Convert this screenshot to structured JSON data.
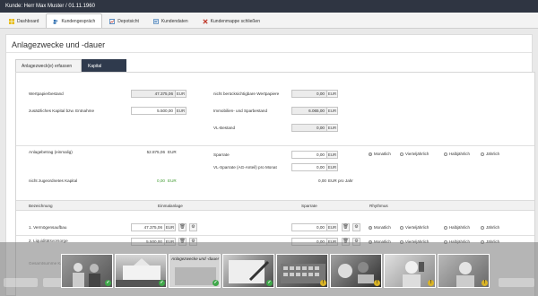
{
  "window": {
    "title": "Kunde: Herr Max Muster / 01.11.1960"
  },
  "nav": {
    "tabs": [
      {
        "label": "Dashboard",
        "icon": "dashboard-icon",
        "color": "#e6b800"
      },
      {
        "label": "Kundengespräch",
        "icon": "conversation-icon",
        "color": "#2f6fb0"
      },
      {
        "label": "Depotsicht",
        "icon": "depot-icon",
        "color": "#2f6fb0"
      },
      {
        "label": "Kundendaten",
        "icon": "customer-data-icon",
        "color": "#2f6fb0"
      },
      {
        "label": "Kundenmappe schließen",
        "icon": "close-x-icon",
        "color": "#c0392b"
      }
    ]
  },
  "page": {
    "title": "Anlagezwecke und -dauer",
    "subtabs": [
      "Anlagezweck(e) erfassen",
      "Kapital zuordnen"
    ]
  },
  "form": {
    "wertpapierbestand": {
      "label": "Wertpapierbestand",
      "value": "47.375,06",
      "unit": "EUR"
    },
    "zusatz": {
      "label": "zusätzliches Kapital bzw. Entnahme",
      "value": "5.500,00",
      "unit": "EUR"
    },
    "nicht_beruecks": {
      "label": "nicht berücksichtigbare Wertpapiere",
      "value": "0,00",
      "unit": "EUR"
    },
    "immobilien": {
      "label": "Immobilien- und Sparbestand",
      "value": "6.065,00",
      "unit": "EUR"
    },
    "vl_bestand": {
      "label": "VL-Bestand",
      "value": "0,00",
      "unit": "EUR"
    },
    "anlagebetrag": {
      "label": "Anlagebetrag (einmalig)",
      "value": "52.875,06",
      "unit": "EUR"
    },
    "sparrate": {
      "label": "Sparrate",
      "value": "0,00",
      "unit": "EUR"
    },
    "vl_sparrate": {
      "label": "VL-Sparrate (AG-Anteil) pro Monat",
      "value": "0,00",
      "unit": "EUR"
    },
    "nicht_zugeordnet": {
      "label": "nicht zugeordnetes Kapital",
      "value": "0,00",
      "unit": "EUR"
    },
    "pro_jahr": {
      "value": "0,00",
      "unit": "EUR pro Jahr"
    },
    "rhythm": [
      "Monatlich",
      "Vierteljährlich",
      "Halbjährlich",
      "Jährlich"
    ]
  },
  "table": {
    "headers": {
      "bezeichnung": "Bezeichnung",
      "einmalanlage": "Einmalanlage",
      "sparrate": "Sparrate",
      "rhythmus": "Rhythmus"
    },
    "rows": [
      {
        "name": "1. Vermögensaufbau",
        "einmal": "47.375,06",
        "spar": "0,00",
        "unit": "EUR"
      },
      {
        "name": "2. Liquiditätsvorsorge",
        "einmal": "5.500,00",
        "spar": "0,00",
        "unit": "EUR"
      }
    ],
    "row3_label": "Gesamtsumme Kapital"
  },
  "filmstrip": {
    "caption": "Anlagezwecke und -dauer",
    "thumbs": [
      {
        "name": "thumb-people",
        "badge": "ok",
        "tone": "#777"
      },
      {
        "name": "thumb-building",
        "badge": "ok",
        "tone": "#8a8a8a"
      },
      {
        "name": "thumb-current",
        "badge": "ok",
        "tone": "#bcbcbc"
      },
      {
        "name": "thumb-writing",
        "badge": "ok",
        "tone": "#6f6f6f"
      },
      {
        "name": "thumb-keyboard",
        "badge": "warn",
        "tone": "#666"
      },
      {
        "name": "thumb-objects",
        "badge": "warn",
        "tone": "#5c5c5c"
      },
      {
        "name": "thumb-phone",
        "badge": "warn",
        "tone": "#9a9a9a"
      },
      {
        "name": "thumb-portrait",
        "badge": "warn",
        "tone": "#888"
      }
    ]
  }
}
